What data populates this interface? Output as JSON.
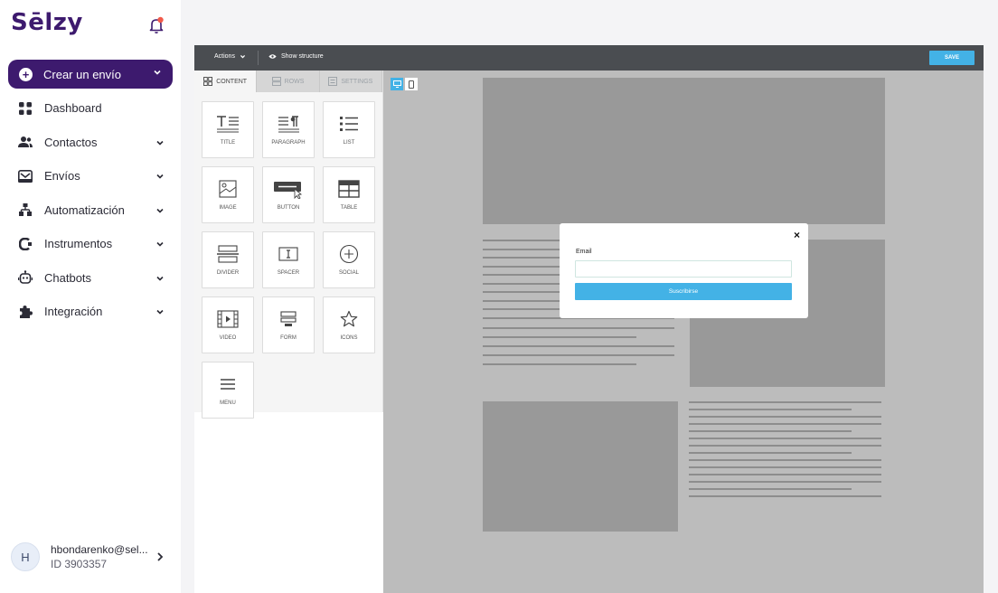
{
  "brand": {
    "name": "Sēlzy",
    "accent": "#3d1a6e",
    "bell_dot": "#f25a4a"
  },
  "sidebar": {
    "create_label": "Crear un envío",
    "items": [
      {
        "label": "Dashboard",
        "icon": "grid-icon",
        "has_chevron": false
      },
      {
        "label": "Contactos",
        "icon": "users-icon",
        "has_chevron": true
      },
      {
        "label": "Envíos",
        "icon": "mail-icon",
        "has_chevron": true
      },
      {
        "label": "Automatización",
        "icon": "hierarchy-icon",
        "has_chevron": true
      },
      {
        "label": "Instrumentos",
        "icon": "tools-icon",
        "has_chevron": true
      },
      {
        "label": "Chatbots",
        "icon": "robot-icon",
        "has_chevron": true
      },
      {
        "label": "Integración",
        "icon": "puzzle-icon",
        "has_chevron": true
      }
    ],
    "user": {
      "initial": "H",
      "email": "hbondarenko@sel...",
      "id": "ID 3903357"
    }
  },
  "editor": {
    "actions_label": "Actions",
    "structure_label": "Show structure",
    "save_label": "SAVE",
    "accent": "#43b2e6",
    "tabs": [
      {
        "label": "CONTENT",
        "active": true
      },
      {
        "label": "ROWS",
        "active": false
      },
      {
        "label": "SETTINGS",
        "active": false
      }
    ],
    "tiles": [
      "TITLE",
      "PARAGRAPH",
      "LIST",
      "IMAGE",
      "BUTTON",
      "TABLE",
      "DIVIDER",
      "SPACER",
      "SOCIAL",
      "VIDEO",
      "FORM",
      "ICONS",
      "MENU"
    ],
    "device": {
      "desktop_active": true
    }
  },
  "popup": {
    "email_label": "Email",
    "email_value": "",
    "submit_label": "Suscribirse",
    "close_glyph": "×"
  }
}
